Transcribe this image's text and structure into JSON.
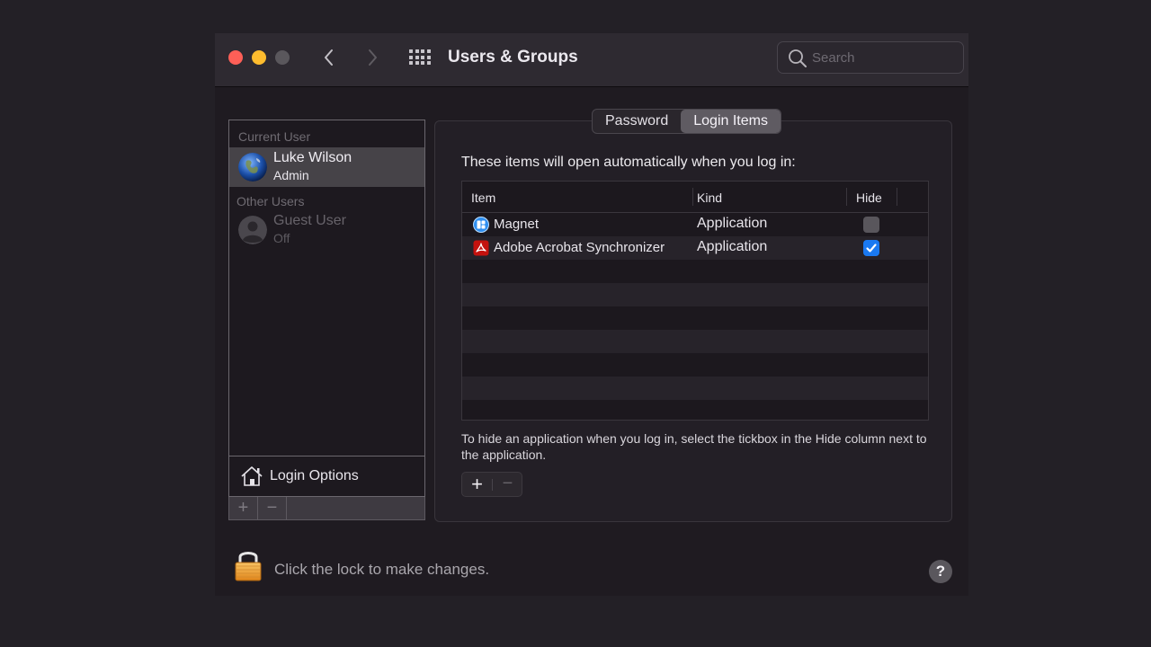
{
  "window": {
    "title": "Users & Groups",
    "search_placeholder": "Search"
  },
  "sidebar": {
    "current_user_label": "Current User",
    "current_user": {
      "name": "Luke Wilson",
      "role": "Admin",
      "avatar": "earth-globe"
    },
    "other_users_label": "Other Users",
    "other_users": [
      {
        "name": "Guest User",
        "status": "Off",
        "avatar": "generic-person"
      }
    ],
    "login_options_label": "Login Options",
    "add_label": "+",
    "remove_label": "−"
  },
  "tabs": [
    {
      "label": "Password",
      "active": false
    },
    {
      "label": "Login Items",
      "active": true
    }
  ],
  "login_items": {
    "intro": "These items will open automatically when you log in:",
    "columns": [
      "Item",
      "Kind",
      "Hide"
    ],
    "rows": [
      {
        "item": "Magnet",
        "kind": "Application",
        "hide": false,
        "icon": "magnet-app"
      },
      {
        "item": "Adobe Acrobat Synchronizer",
        "kind": "Application",
        "hide": true,
        "icon": "adobe-acrobat-app"
      }
    ],
    "hint": "To hide an application when you log in, select the tickbox in the Hide column next to the application.",
    "add_label": "+",
    "remove_label": "−"
  },
  "footer": {
    "lock_text": "Click the lock to make changes.",
    "help_label": "?"
  },
  "colors": {
    "accent": "#1a79f1",
    "close": "#fe5f57",
    "minimize": "#febc2e",
    "maximize_disabled": "#5a575c",
    "adobe_red": "#c4120e",
    "magnet_blue": "#2f8ff0"
  }
}
